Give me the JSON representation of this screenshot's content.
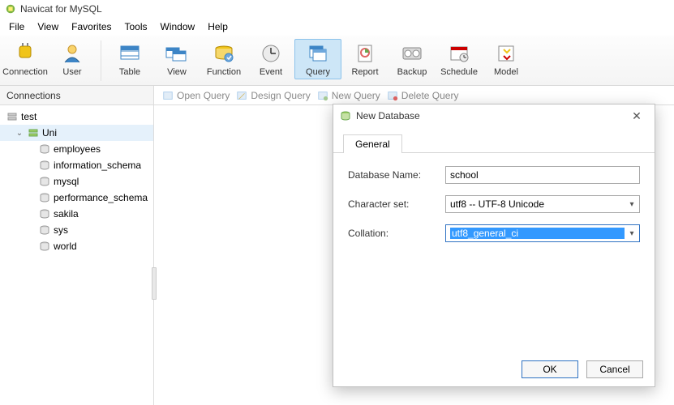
{
  "app": {
    "title": "Navicat for MySQL"
  },
  "menu": {
    "items": [
      "File",
      "View",
      "Favorites",
      "Tools",
      "Window",
      "Help"
    ]
  },
  "toolbar": {
    "groups": [
      [
        {
          "id": "connection",
          "label": "Connection"
        },
        {
          "id": "user",
          "label": "User"
        }
      ],
      [
        {
          "id": "table",
          "label": "Table"
        },
        {
          "id": "view",
          "label": "View"
        },
        {
          "id": "function",
          "label": "Function"
        },
        {
          "id": "event",
          "label": "Event"
        },
        {
          "id": "query",
          "label": "Query",
          "active": true
        },
        {
          "id": "report",
          "label": "Report"
        },
        {
          "id": "backup",
          "label": "Backup"
        },
        {
          "id": "schedule",
          "label": "Schedule"
        },
        {
          "id": "model",
          "label": "Model"
        }
      ]
    ]
  },
  "secondbar": {
    "panel_title": "Connections",
    "buttons": [
      "Open Query",
      "Design Query",
      "New Query",
      "Delete Query"
    ]
  },
  "tree": {
    "items": [
      {
        "label": "test",
        "level": 1,
        "icon": "server-icon"
      },
      {
        "label": "Uni",
        "level": 2,
        "icon": "server-open-icon",
        "expanded": true,
        "selected": true,
        "children": [
          {
            "label": "employees",
            "icon": "db-icon"
          },
          {
            "label": "information_schema",
            "icon": "db-icon"
          },
          {
            "label": "mysql",
            "icon": "db-icon"
          },
          {
            "label": "performance_schema",
            "icon": "db-icon"
          },
          {
            "label": "sakila",
            "icon": "db-icon"
          },
          {
            "label": "sys",
            "icon": "db-icon"
          },
          {
            "label": "world",
            "icon": "db-icon"
          }
        ]
      }
    ]
  },
  "dialog": {
    "title": "New Database",
    "tab": "General",
    "fields": {
      "db_name_label": "Database Name:",
      "db_name_value": "school",
      "charset_label": "Character set:",
      "charset_value": "utf8 -- UTF-8 Unicode",
      "collation_label": "Collation:",
      "collation_value": "utf8_general_ci"
    },
    "buttons": {
      "ok": "OK",
      "cancel": "Cancel"
    }
  }
}
